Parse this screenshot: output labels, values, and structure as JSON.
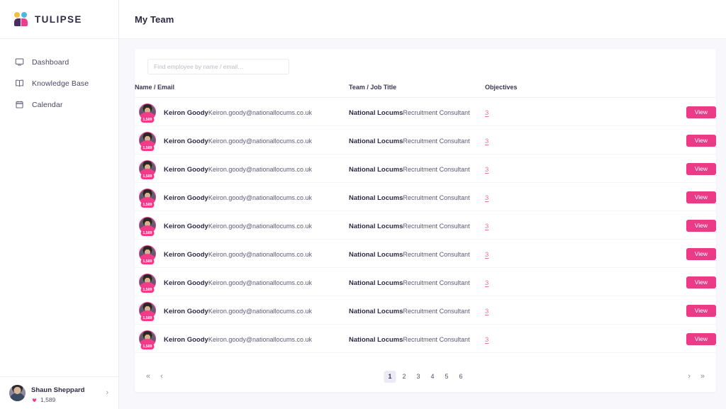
{
  "brand": {
    "name": "TULIPSE",
    "logo_icon": "tulipse-logo-icon"
  },
  "sidebar": {
    "items": [
      {
        "label": "Dashboard",
        "icon": "monitor-icon"
      },
      {
        "label": "Knowledge Base",
        "icon": "book-icon"
      },
      {
        "label": "Calendar",
        "icon": "calendar-icon"
      }
    ],
    "profile": {
      "name": "Shaun Sheppard",
      "points": "1,589",
      "points_icon": "tulip-icon",
      "chevron_icon": "chevron-right-icon"
    }
  },
  "header": {
    "title": "My Team"
  },
  "search": {
    "placeholder": "Find employee by name / email…",
    "value": ""
  },
  "table": {
    "columns": [
      "Name / Email",
      "Team / Job Title",
      "Objectives",
      ""
    ],
    "action_label": "View",
    "rows": [
      {
        "name": "Keiron Goody",
        "email": "Keiron.goody@nationallocums.co.uk",
        "badge": "1,589",
        "team": "National Locums",
        "role": "Recruitment Consultant",
        "objectives": "3"
      },
      {
        "name": "Keiron Goody",
        "email": "Keiron.goody@nationallocums.co.uk",
        "badge": "1,589",
        "team": "National Locums",
        "role": "Recruitment Consultant",
        "objectives": "3"
      },
      {
        "name": "Keiron Goody",
        "email": "Keiron.goody@nationallocums.co.uk",
        "badge": "1,589",
        "team": "National Locums",
        "role": "Recruitment Consultant",
        "objectives": "3"
      },
      {
        "name": "Keiron Goody",
        "email": "Keiron.goody@nationallocums.co.uk",
        "badge": "1,589",
        "team": "National Locums",
        "role": "Recruitment Consultant",
        "objectives": "3"
      },
      {
        "name": "Keiron Goody",
        "email": "Keiron.goody@nationallocums.co.uk",
        "badge": "1,589",
        "team": "National Locums",
        "role": "Recruitment Consultant",
        "objectives": "3"
      },
      {
        "name": "Keiron Goody",
        "email": "Keiron.goody@nationallocums.co.uk",
        "badge": "1,589",
        "team": "National Locums",
        "role": "Recruitment Consultant",
        "objectives": "3"
      },
      {
        "name": "Keiron Goody",
        "email": "Keiron.goody@nationallocums.co.uk",
        "badge": "1,589",
        "team": "National Locums",
        "role": "Recruitment Consultant",
        "objectives": "3"
      },
      {
        "name": "Keiron Goody",
        "email": "Keiron.goody@nationallocums.co.uk",
        "badge": "1,589",
        "team": "National Locums",
        "role": "Recruitment Consultant",
        "objectives": "3"
      },
      {
        "name": "Keiron Goody",
        "email": "Keiron.goody@nationallocums.co.uk",
        "badge": "1,589",
        "team": "National Locums",
        "role": "Recruitment Consultant",
        "objectives": "3"
      }
    ]
  },
  "pagination": {
    "first_label": "«",
    "prev_label": "‹",
    "next_label": "›",
    "last_label": "»",
    "pages": [
      "1",
      "2",
      "3",
      "4",
      "5",
      "6"
    ],
    "current": "1"
  },
  "colors": {
    "accent_pink": "#ed3a87",
    "link_pink": "#f06a9f",
    "logo_yellow": "#f6c143",
    "logo_blue": "#4db7e8",
    "logo_purple": "#4c2a63",
    "text_dark": "#2e2a45",
    "page_bg": "#f8f7fb"
  }
}
